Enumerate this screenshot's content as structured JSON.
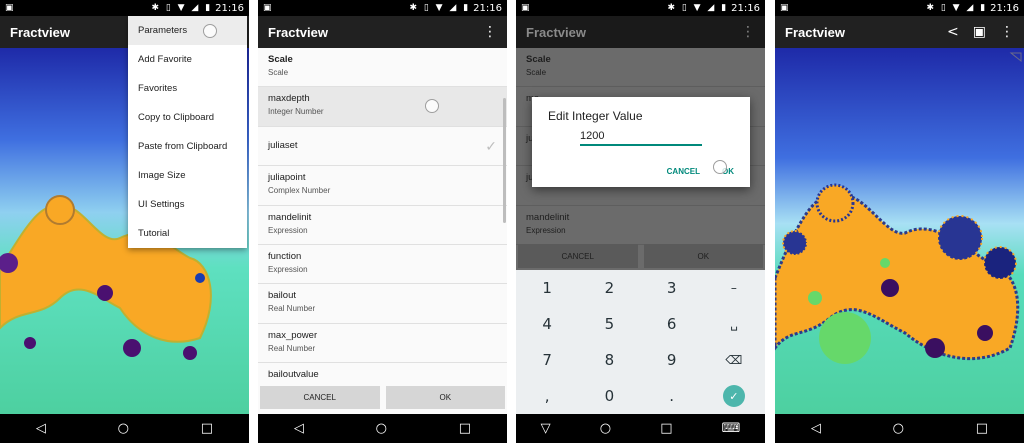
{
  "status": {
    "time": "21:16",
    "left_icon": "▣",
    "icons": "✱ ▯ ▼ ◢ ▮"
  },
  "screen1": {
    "title": "Fractview",
    "menu": [
      "Parameters",
      "Add Favorite",
      "Favorites",
      "Copy to Clipboard",
      "Paste from Clipboard",
      "Image Size",
      "UI Settings",
      "Tutorial"
    ]
  },
  "screen2": {
    "title": "Fractview",
    "overflow_icon": "⋮",
    "params": [
      {
        "name": "Scale",
        "type": "Scale"
      },
      {
        "name": "maxdepth",
        "type": "Integer Number"
      },
      {
        "name": "juliaset",
        "type": ""
      },
      {
        "name": "juliapoint",
        "type": "Complex Number"
      },
      {
        "name": "mandelinit",
        "type": "Expression"
      },
      {
        "name": "function",
        "type": "Expression"
      },
      {
        "name": "bailout",
        "type": "Real Number"
      },
      {
        "name": "max_power",
        "type": "Real Number"
      },
      {
        "name": "bailoutvalue",
        "type": "Expression"
      }
    ],
    "cancel": "CANCEL",
    "ok": "OK"
  },
  "screen3": {
    "title": "Fractview",
    "params": [
      {
        "name": "Scale",
        "type": "Scale"
      },
      {
        "name": "ma",
        "type": ""
      },
      {
        "name": "ju",
        "type": ""
      },
      {
        "name": "ju",
        "type": ""
      },
      {
        "name": "mandelinit",
        "type": "Expression"
      }
    ],
    "cancel": "CANCEL",
    "ok": "OK",
    "dialog": {
      "title": "Edit Integer Value",
      "value": "1200",
      "cancel": "CANCEL",
      "ok": "OK"
    },
    "keys": [
      [
        "1",
        "2",
        "3",
        "–"
      ],
      [
        "4",
        "5",
        "6",
        "␣"
      ],
      [
        "7",
        "8",
        "9",
        "⌫"
      ],
      [
        ",",
        "0",
        ".",
        "✓"
      ]
    ]
  },
  "screen4": {
    "title": "Fractview",
    "share_icon": "<",
    "image_icon": "▣",
    "overflow_icon": "⋮"
  },
  "nav": {
    "back": "◁",
    "home": "○",
    "recents": "□",
    "keyboard": "⌨"
  },
  "colors": {
    "appbar": "#212121",
    "accent": "#00897b",
    "fractal_blue": "#3f51b5",
    "fractal_gold": "#f9a825",
    "fractal_cyan": "#4dd0b0"
  }
}
